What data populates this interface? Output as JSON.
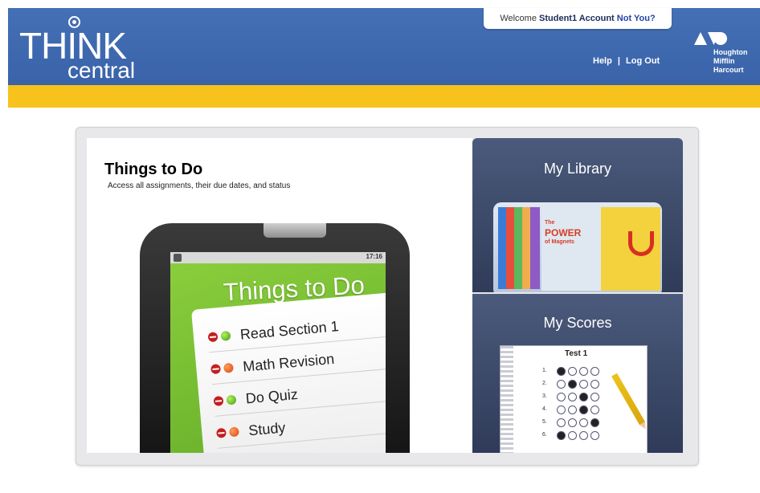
{
  "header": {
    "logo_think": "THINK",
    "logo_central": "central",
    "welcome_prefix": "Welcome ",
    "welcome_user": "Student1 Account",
    "welcome_not_you": "Not You?",
    "help": "Help",
    "separator": "|",
    "logout": "Log Out",
    "publisher_line1": "Houghton",
    "publisher_line2": "Mifflin",
    "publisher_line3": "Harcourt",
    "colors": {
      "header_blue": "#3f6aaf",
      "accent_yellow": "#f7c21c"
    }
  },
  "todo_panel": {
    "title": "Things to Do",
    "subtitle": "Access all assignments, their due dates, and status",
    "phone_time": "17:16",
    "screen_title": "Things to Do",
    "items": [
      {
        "label": "Read Section 1",
        "status": "green"
      },
      {
        "label": "Math Revision",
        "status": "orange"
      },
      {
        "label": "Do Quiz",
        "status": "green"
      },
      {
        "label": "Study",
        "status": "orange"
      }
    ]
  },
  "library_card": {
    "title": "My Library",
    "book_title_line1": "The",
    "book_title_line2": "POWER",
    "book_title_line3": "of Magnets"
  },
  "scores_card": {
    "title": "My Scores",
    "sheet_title": "Test 1",
    "rows": [
      "1.",
      "2.",
      "3.",
      "4.",
      "5.",
      "6."
    ]
  }
}
